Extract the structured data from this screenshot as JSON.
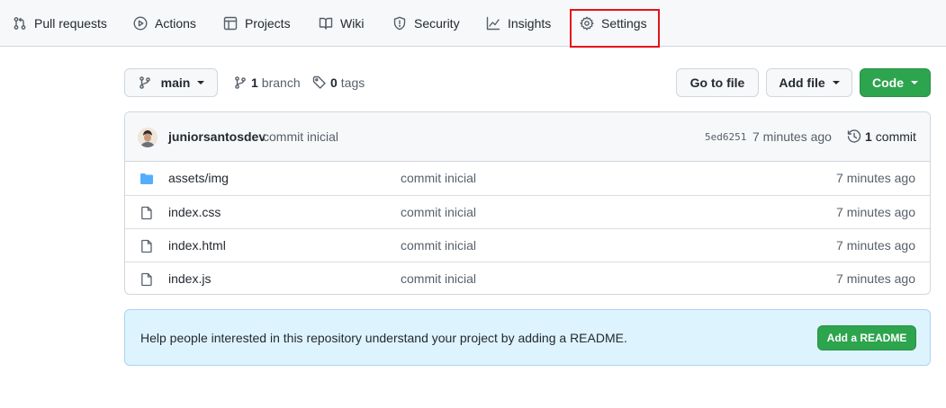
{
  "nav": {
    "items": [
      {
        "label": "Pull requests",
        "icon": "pull-request-icon"
      },
      {
        "label": "Actions",
        "icon": "play-icon"
      },
      {
        "label": "Projects",
        "icon": "table-icon"
      },
      {
        "label": "Wiki",
        "icon": "book-icon"
      },
      {
        "label": "Security",
        "icon": "shield-icon"
      },
      {
        "label": "Insights",
        "icon": "graph-icon"
      },
      {
        "label": "Settings",
        "icon": "gear-icon"
      }
    ],
    "highlight_color": "#e5131c"
  },
  "toolbar": {
    "branch_label": "main",
    "branch_count": "1",
    "branch_word": "branch",
    "tag_count": "0",
    "tag_word": "tags",
    "go_to_file": "Go to file",
    "add_file": "Add file",
    "code": "Code"
  },
  "commit": {
    "author": "juniorsantosdev",
    "message": "commit inicial",
    "sha": "5ed6251",
    "time": "7 minutes ago",
    "count": "1",
    "count_word": "commit"
  },
  "files": [
    {
      "name": "assets/img",
      "type": "folder",
      "commit": "commit inicial",
      "age": "7 minutes ago"
    },
    {
      "name": "index.css",
      "type": "file",
      "commit": "commit inicial",
      "age": "7 minutes ago"
    },
    {
      "name": "index.html",
      "type": "file",
      "commit": "commit inicial",
      "age": "7 minutes ago"
    },
    {
      "name": "index.js",
      "type": "file",
      "commit": "commit inicial",
      "age": "7 minutes ago"
    }
  ],
  "readme_banner": {
    "text": "Help people interested in this repository understand your project by adding a README.",
    "button": "Add a README"
  },
  "colors": {
    "accent_green": "#2da44e",
    "folder_blue": "#54aeff",
    "banner_bg": "#ddf4ff"
  }
}
